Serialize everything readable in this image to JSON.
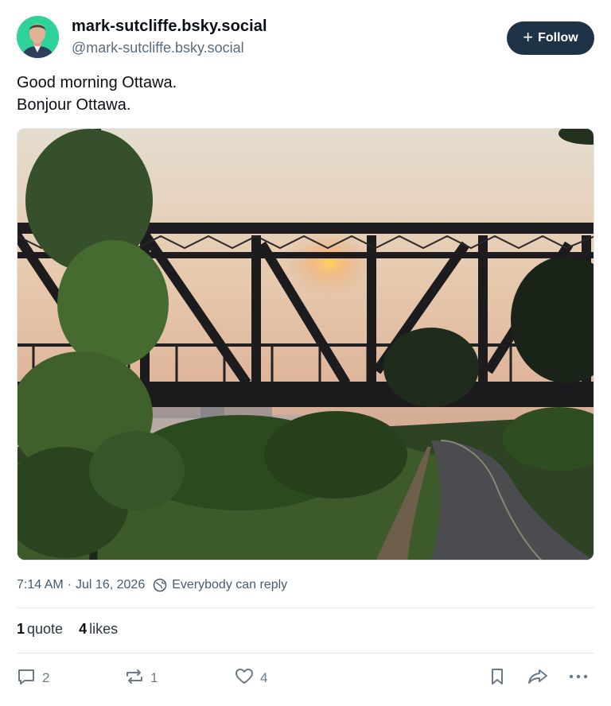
{
  "author": {
    "display_name": "mark-sutcliffe.bsky.social",
    "handle": "@mark-sutcliffe.bsky.social"
  },
  "follow_button": {
    "label": "Follow",
    "icon": "plus-icon"
  },
  "post": {
    "lines": [
      "Good morning Ottawa.",
      "Bonjour Ottawa."
    ],
    "time": "7:14 AM",
    "separator": "·",
    "date": "Jul 16, 2026",
    "reply_setting": "Everybody can reply"
  },
  "stats": {
    "quotes_count": "1",
    "quotes_label": "quote",
    "likes_count": "4",
    "likes_label": "likes"
  },
  "actions": {
    "reply_count": "2",
    "repost_count": "1",
    "like_count": "4"
  },
  "colors": {
    "follow_bg": "#1f3347",
    "meta_text": "#4b5a68",
    "avatar_bg": "#2fd39a"
  }
}
